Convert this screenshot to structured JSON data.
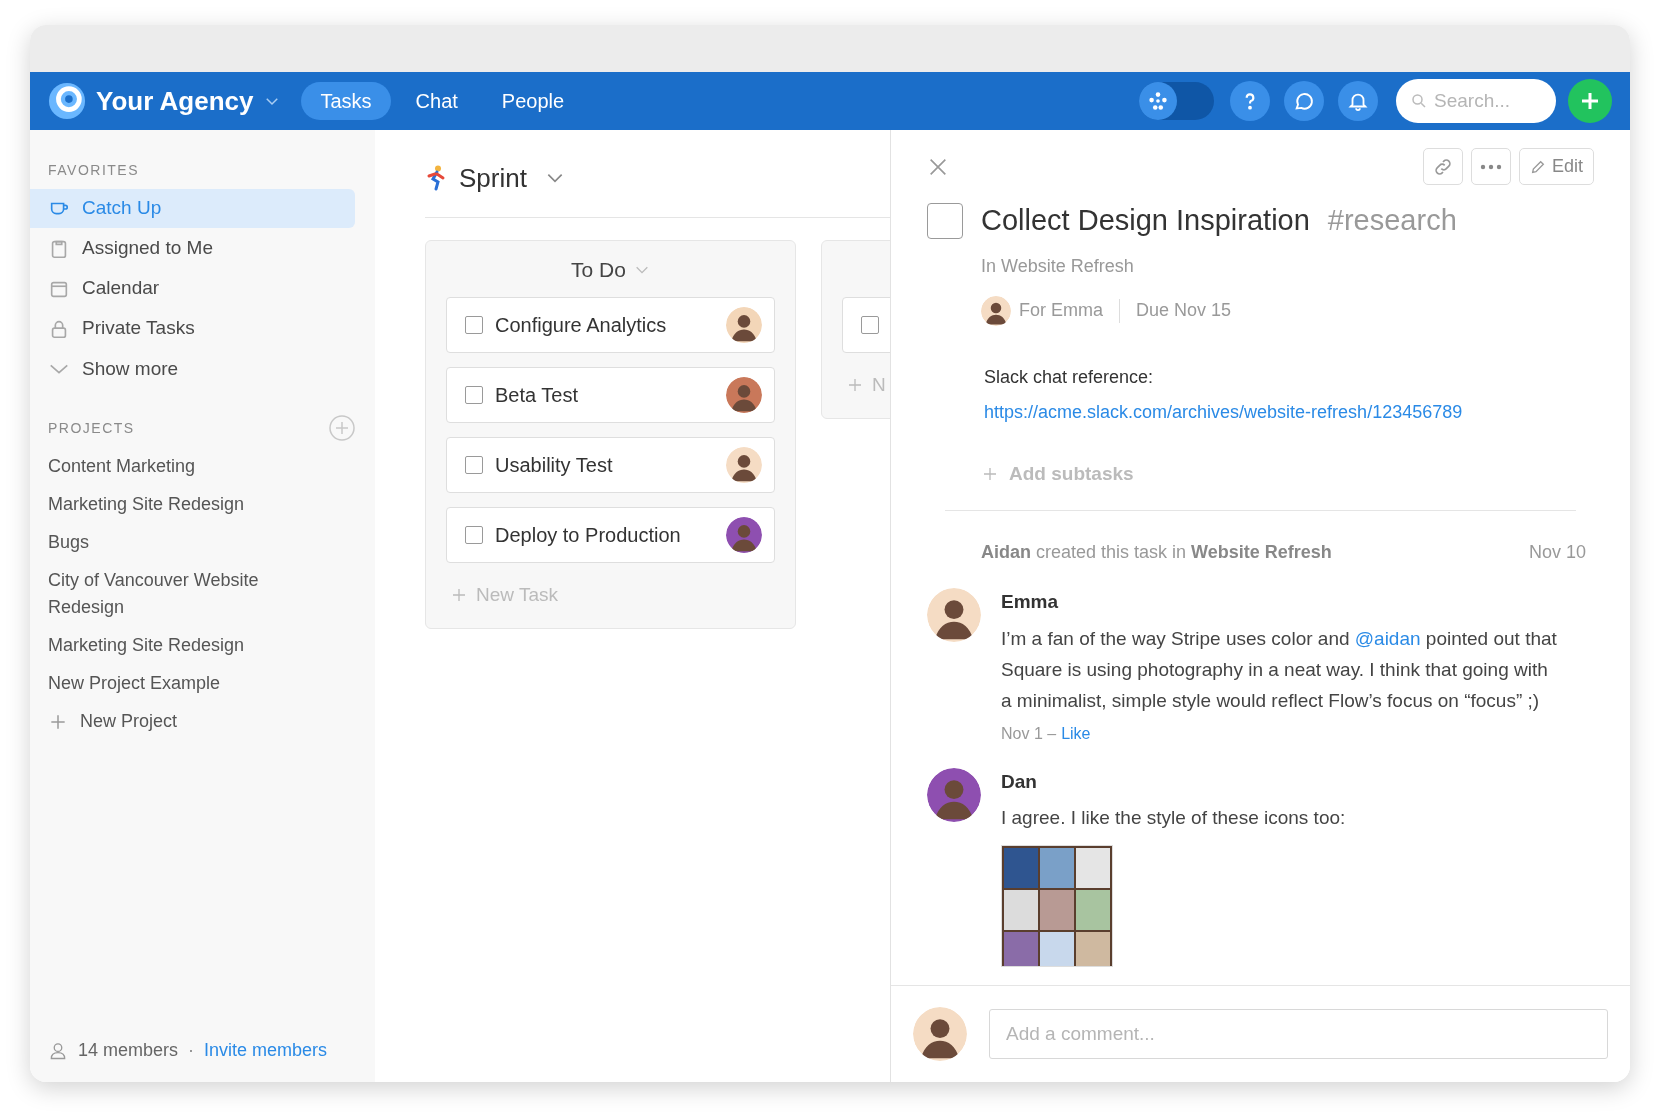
{
  "header": {
    "workspace": "Your Agency",
    "nav": [
      {
        "label": "Tasks",
        "selected": true
      },
      {
        "label": "Chat",
        "selected": false
      },
      {
        "label": "People",
        "selected": false
      }
    ],
    "search": {
      "placeholder": "Search..."
    },
    "toggle": {
      "on": false
    }
  },
  "sidebar": {
    "favorites_heading": "FAVORITES",
    "favorites": [
      {
        "label": "Catch Up",
        "kind": "cup",
        "selected": true
      },
      {
        "label": "Assigned to Me",
        "kind": "clipboard",
        "selected": false
      },
      {
        "label": "Calendar",
        "kind": "calendar",
        "selected": false
      },
      {
        "label": "Private Tasks",
        "kind": "lock",
        "selected": false
      }
    ],
    "show_more": "Show more",
    "projects_heading": "PROJECTS",
    "projects": [
      "Content Marketing",
      "Marketing Site Redesign",
      "Bugs",
      "City of Vancouver Website Redesign",
      "Marketing Site Redesign",
      "New Project Example"
    ],
    "new_project": "New Project",
    "members": "14 members",
    "separator": "·",
    "invite": "Invite members"
  },
  "board": {
    "title": "Sprint",
    "columns": [
      {
        "title": "To Do",
        "tasks": [
          {
            "title": "Configure Analytics",
            "done": false
          },
          {
            "title": "Beta Test",
            "done": false
          },
          {
            "title": "Usability Test",
            "done": false
          },
          {
            "title": "Deploy to Production",
            "done": false
          }
        ],
        "new_task": "New Task"
      },
      {
        "tasks": [
          {
            "done": false
          }
        ],
        "new_task": "N"
      }
    ]
  },
  "detail": {
    "edit": "Edit",
    "completed": false,
    "title": "Collect Design Inspiration",
    "tag": "#research",
    "project": "In Website Refresh",
    "assignee": "For Emma",
    "due": "Due Nov 15",
    "description_label": "Slack chat reference:",
    "link": "https://acme.slack.com/archives/website-refresh/123456789",
    "add_subtasks": "Add subtasks",
    "activity": {
      "text": "**Aidan** created this task in **Website Refresh**",
      "date": "Nov 10"
    },
    "comments": [
      {
        "author": "Emma",
        "before": "I’m a fan of the way Stripe uses color and ",
        "mention": "@aidan",
        "after": " pointed out that Square is using photography in a neat way. I think that going with a minimalist, simple style would reflect Flow’s focus on “focus” ;)",
        "date": "Nov 1 –",
        "like": "Like"
      },
      {
        "author": "Dan",
        "text": "I agree. I like the style of these icons too:"
      }
    ],
    "comment_field": {
      "placeholder": "Add a comment..."
    }
  }
}
